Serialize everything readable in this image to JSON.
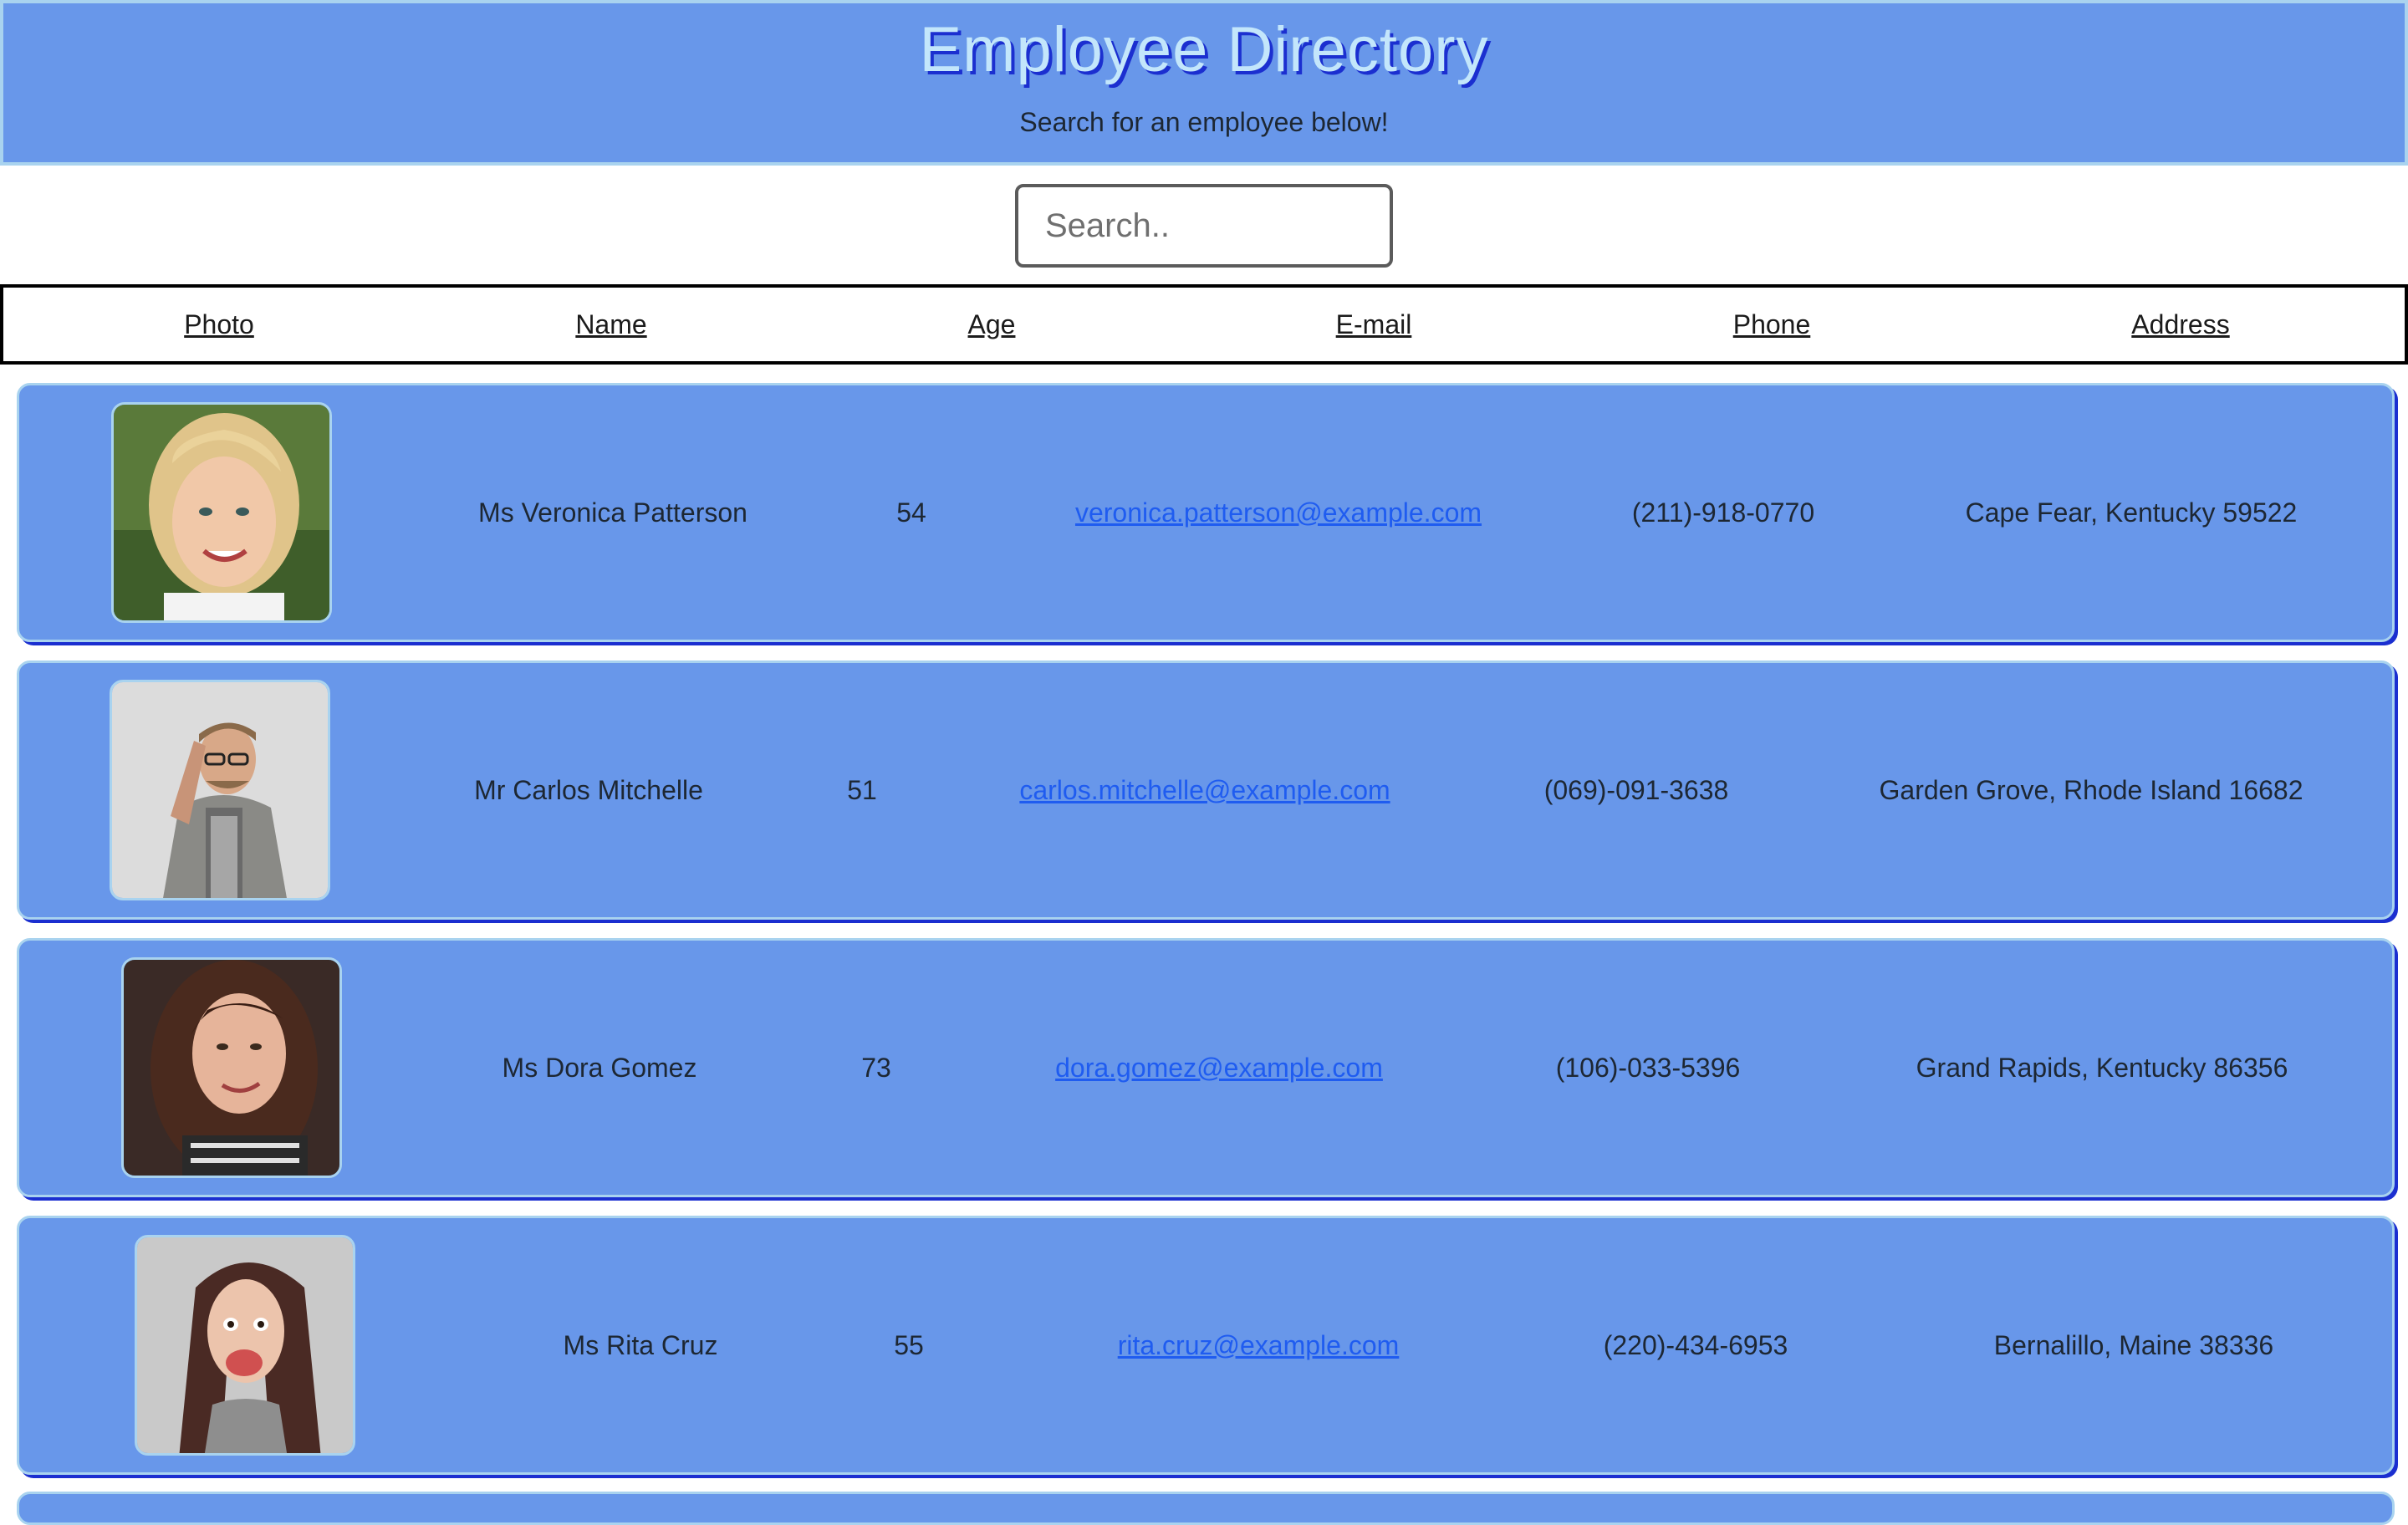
{
  "header": {
    "title": "Employee Directory",
    "subtitle": "Search for an employee below!"
  },
  "search": {
    "placeholder": "Search.."
  },
  "table": {
    "columns": [
      "Photo",
      "Name",
      "Age",
      "E-mail",
      "Phone",
      "Address"
    ],
    "rows": [
      {
        "photo_icon": "portrait-photo",
        "name": "Ms Veronica Patterson",
        "age": "54",
        "email": "veronica.patterson@example.com",
        "phone": "(211)-918-0770",
        "address": "Cape Fear, Kentucky 59522"
      },
      {
        "photo_icon": "portrait-photo",
        "name": "Mr Carlos Mitchelle",
        "age": "51",
        "email": "carlos.mitchelle@example.com",
        "phone": "(069)-091-3638",
        "address": "Garden Grove, Rhode Island 16682"
      },
      {
        "photo_icon": "portrait-photo",
        "name": "Ms Dora Gomez",
        "age": "73",
        "email": "dora.gomez@example.com",
        "phone": "(106)-033-5396",
        "address": "Grand Rapids, Kentucky 86356"
      },
      {
        "photo_icon": "portrait-photo",
        "name": "Ms Rita Cruz",
        "age": "55",
        "email": "rita.cruz@example.com",
        "phone": "(220)-434-6953",
        "address": "Bernalillo, Maine 38336"
      }
    ]
  },
  "colors": {
    "accent": "#6897ea",
    "border": "#a9d3ef",
    "shadow": "#1b2fd0",
    "link": "#1f5cf0"
  }
}
